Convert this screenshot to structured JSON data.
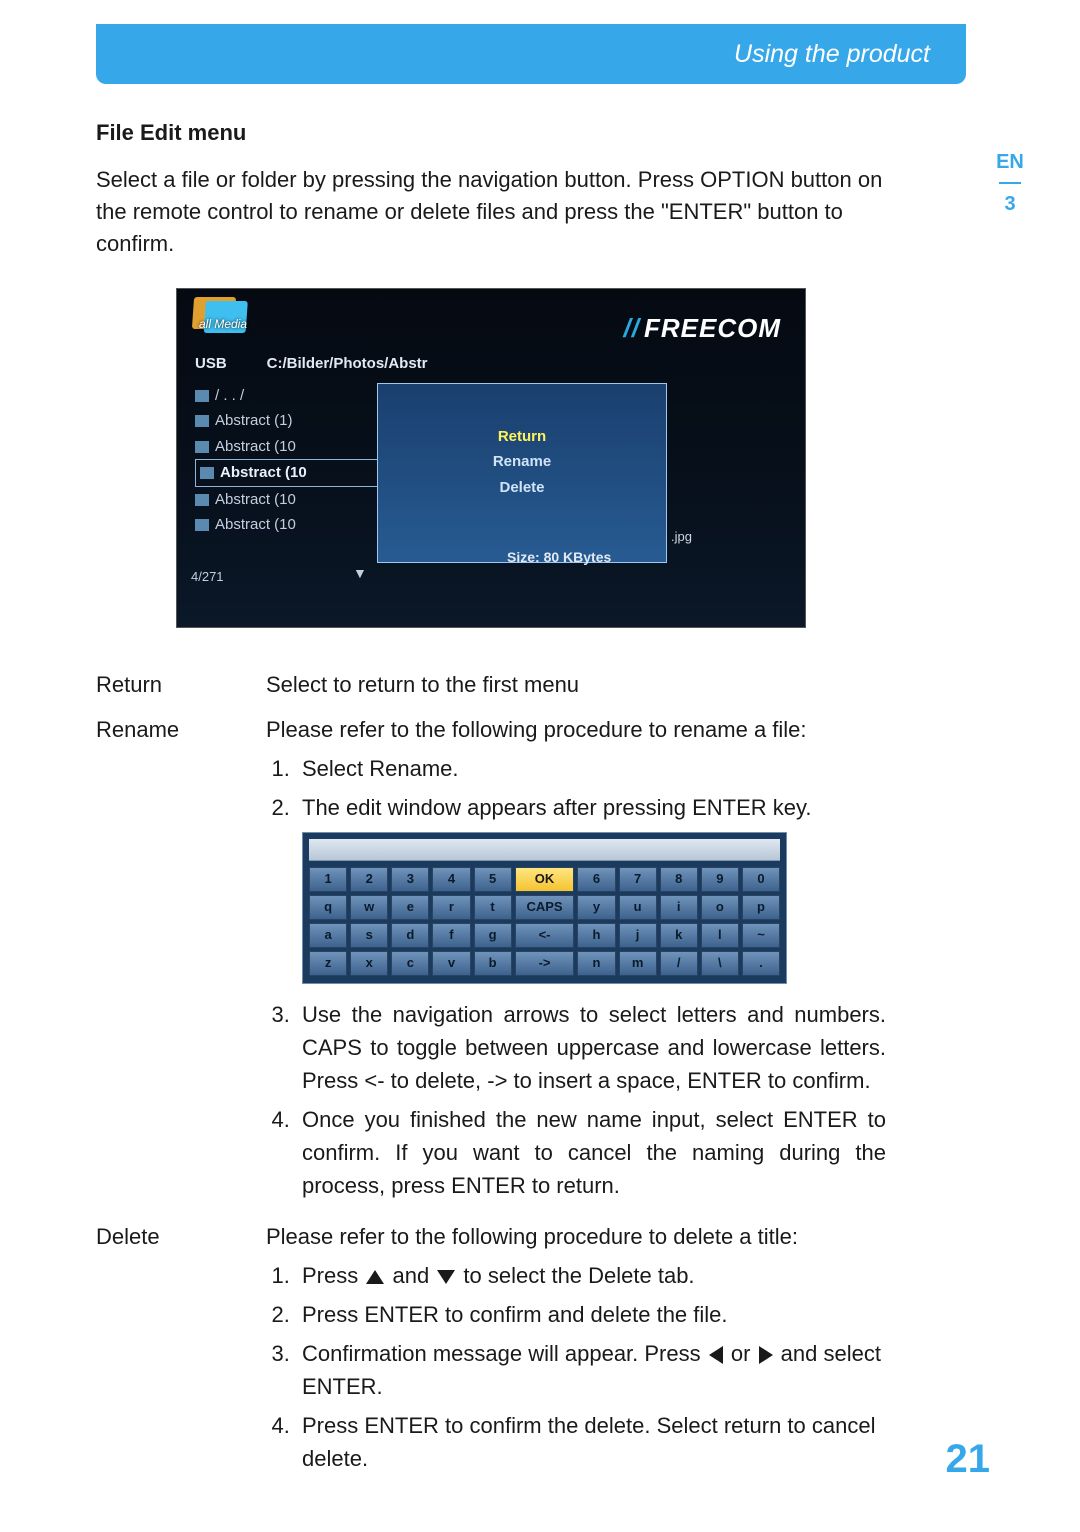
{
  "header": {
    "title": "Using the product"
  },
  "side": {
    "lang": "EN",
    "chapter": "3"
  },
  "section_title": "File Edit menu",
  "intro": "Select a file or folder by pressing the navigation button. Press OPTION button on the remote control to rename or delete files and press the \"ENTER\" button to confirm.",
  "shot1": {
    "allmedia": "all Media",
    "brand_slashes": "//",
    "brand": "FREECOM",
    "drive": "USB",
    "path": "C:/Bilder/Photos/Abstr",
    "files": {
      "up": "/ . . /",
      "items": [
        "Abstract (1)",
        "Abstract (10",
        "Abstract (10",
        "Abstract (10",
        "Abstract (10"
      ],
      "selected_index": 2
    },
    "popup": {
      "return": "Return",
      "rename": "Rename",
      "delete": "Delete"
    },
    "size": "Size: 80 KBytes",
    "ext": ".jpg",
    "count": "4/271"
  },
  "defs": {
    "return": {
      "term": "Return",
      "desc": "Select to return to the first menu"
    },
    "rename": {
      "term": "Rename",
      "desc": "Please refer to the following procedure to rename a file:",
      "steps": {
        "s1": "Select Rename.",
        "s2": "The edit window appears after pressing ENTER key.",
        "s3": "Use the navigation arrows to select letters and numbers. CAPS to toggle between uppercase and lowercase letters. Press <- to delete, -> to insert a space, ENTER to confirm.",
        "s4": "Once you finished the new name input, select ENTER to confirm. If you want to cancel the naming during the process, press ENTER to return."
      }
    },
    "delete": {
      "term": "Delete",
      "desc": "Please refer to the following procedure to delete a title:",
      "steps": {
        "s1_a": "Press ",
        "s1_b": " and ",
        "s1_c": " to select the Delete tab.",
        "s2": "Press ENTER to confirm and delete the file.",
        "s3_a": "Confirmation message will appear. Press ",
        "s3_b": " or ",
        "s3_c": " and select ENTER.",
        "s4": "Press ENTER to confirm the delete. Select return to cancel delete."
      }
    }
  },
  "keyboard": {
    "rows": [
      [
        "1",
        "2",
        "3",
        "4",
        "5",
        "OK",
        "6",
        "7",
        "8",
        "9",
        "0"
      ],
      [
        "q",
        "w",
        "e",
        "r",
        "t",
        "CAPS",
        "y",
        "u",
        "i",
        "o",
        "p"
      ],
      [
        "a",
        "s",
        "d",
        "f",
        "g",
        "<-",
        "h",
        "j",
        "k",
        "l",
        "~"
      ],
      [
        "z",
        "x",
        "c",
        "v",
        "b",
        "->",
        "n",
        "m",
        "/",
        "\\",
        "."
      ]
    ]
  },
  "page_number": "21"
}
